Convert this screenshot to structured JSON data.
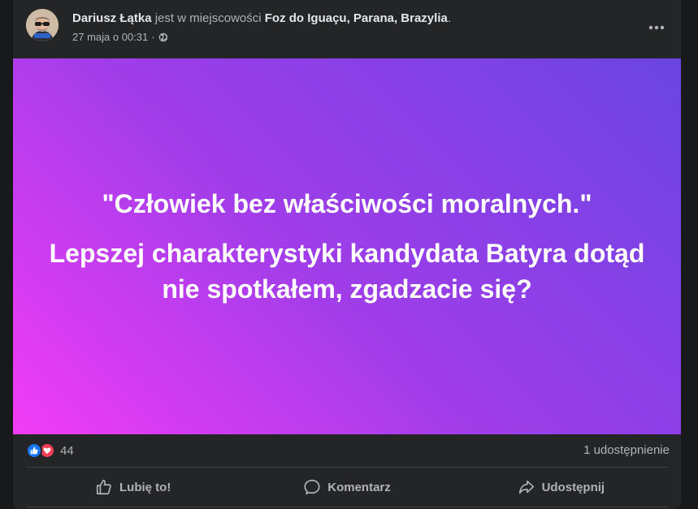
{
  "post": {
    "author": "Dariusz Łątka",
    "location_prefix": "jest w miejscowości",
    "location": "Foz do Iguaçu, Parana, Brazylia",
    "location_suffix": ".",
    "timestamp": "27 maja o 00:31",
    "separator": "·",
    "privacy_icon": "globe-icon",
    "more_icon": "more-horizontal-icon",
    "text_line1": "\"Człowiek bez właściwości moralnych.\"",
    "text_line2": "Lepszej charakterystyki kandydata Batyra dotąd nie spotkałem, zgadzacie się?",
    "background_gradient": [
      "#f23cf6",
      "#a03de9",
      "#6a44e2"
    ]
  },
  "stats": {
    "reaction_icons": [
      "like-icon",
      "love-icon"
    ],
    "reaction_count": "44",
    "shares": "1 udostępnienie"
  },
  "actions": {
    "like_label": "Lubię to!",
    "comment_label": "Komentarz",
    "share_label": "Udostępnij"
  },
  "colors": {
    "card_background": "#242526",
    "page_background": "#18191a",
    "like_blue": "#1877f2",
    "love_red": "#f33e58",
    "muted_text": "#b0b3b8"
  }
}
